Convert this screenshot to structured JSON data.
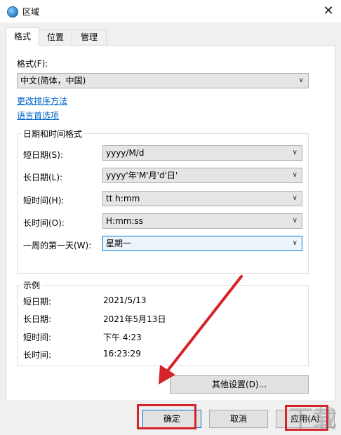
{
  "window": {
    "title": "区域",
    "close_glyph": "✕"
  },
  "tabs": [
    {
      "label": "格式",
      "active": true
    },
    {
      "label": "位置",
      "active": false
    },
    {
      "label": "管理",
      "active": false
    }
  ],
  "format": {
    "label": "格式(F):",
    "value": "中文(简体，中国)"
  },
  "links": {
    "sort": "更改排序方法",
    "language": "语言首选项"
  },
  "datetime_group": {
    "title": "日期和时间格式",
    "rows": [
      {
        "label": "短日期(S):",
        "value": "yyyy/M/d"
      },
      {
        "label": "长日期(L):",
        "value": "yyyy'年'M'月'd'日'"
      },
      {
        "label": "短时间(H):",
        "value": "tt h:mm"
      },
      {
        "label": "长时间(O):",
        "value": "H:mm:ss"
      },
      {
        "label": "一周的第一天(W):",
        "value": "星期一"
      }
    ]
  },
  "example_group": {
    "title": "示例",
    "rows": [
      {
        "label": "短日期:",
        "value": "2021/5/13"
      },
      {
        "label": "长日期:",
        "value": "2021年5月13日"
      },
      {
        "label": "短时间:",
        "value": "下午 4:23"
      },
      {
        "label": "长时间:",
        "value": "16:23:29"
      }
    ]
  },
  "buttons": {
    "other": "其他设置(D)...",
    "ok": "确定",
    "cancel": "取消",
    "apply": "应用(A)"
  },
  "watermark": "下载",
  "colors": {
    "annotation": "#d4242a",
    "link": "#0066cc",
    "accent": "#0078d7"
  }
}
